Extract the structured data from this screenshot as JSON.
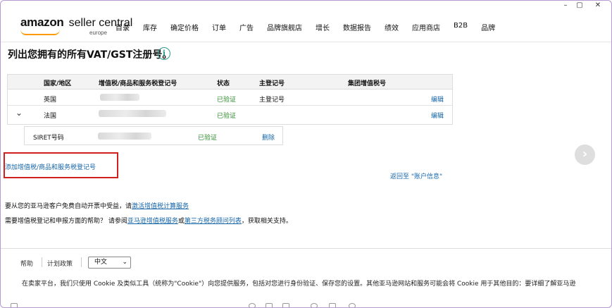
{
  "window": {
    "minimize": "–",
    "maximize": "▢",
    "close": "✕"
  },
  "header": {
    "logo_main": "amazon",
    "logo_sub": "seller central",
    "logo_region": "europe",
    "nav": [
      "目录",
      "库存",
      "确定价格",
      "订单",
      "广告",
      "品牌旗舰店",
      "增长",
      "数据报告",
      "绩效",
      "应用商店",
      "B2B",
      "品牌"
    ]
  },
  "page": {
    "title": "列出您拥有的所有VAT/GST注册号。",
    "info_icon": "i"
  },
  "table": {
    "headers": {
      "country": "国家/地区",
      "vat_number": "增值税/商品和服务税登记号",
      "status": "状态",
      "primary": "主登记号",
      "group": "集团增值税号"
    },
    "rows": [
      {
        "country": "英国",
        "status": "已验证",
        "primary": "主登记号",
        "action": "编辑"
      },
      {
        "country": "法国",
        "status": "已验证",
        "primary": "",
        "action": "编辑"
      }
    ],
    "siret": {
      "label": "SIRET号码",
      "status": "已验证",
      "action": "删除"
    }
  },
  "actions": {
    "add_vat": "添加增值税/商品和服务税登记号",
    "back_to_account": "返回至 \"账户信息\""
  },
  "info": {
    "line1_prefix": "要从您的亚马逊客户免费自动开票中受益，请",
    "line1_link": "激活增值税计算服务",
    "line2_prefix": "需要增值税登记和申报方面的帮助？ 请参阅",
    "line2_link1": "亚马逊增值税服务",
    "line2_mid": "或",
    "line2_link2": "第三方税务顾问列表",
    "line2_suffix": "，获取相关支持。"
  },
  "footer": {
    "help": "帮助",
    "policy": "计划政策",
    "language": "中文",
    "cookie_text": "在卖家平台，我们只使用 Cookie 及类似工具（统称为\"Cookie\"）向您提供服务，包括对您进行身份验证、保存您的设置。其他亚马逊网站和服务可能会将 Cookie 用于其他目的：要详细了解亚马逊"
  },
  "colors": {
    "link": "#1565a8",
    "verified": "#2e8a2e",
    "highlight": "#d02020",
    "brand_smile": "#ff9900"
  }
}
